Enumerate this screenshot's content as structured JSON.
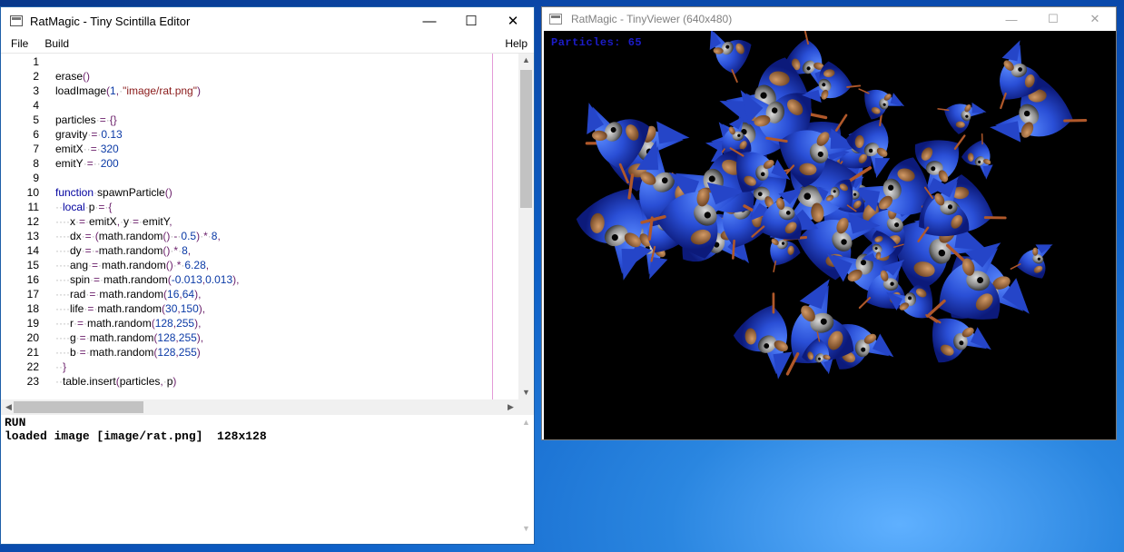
{
  "editor": {
    "title": "RatMagic - Tiny Scintilla Editor",
    "menu": {
      "file": "File",
      "build": "Build",
      "help": "Help"
    },
    "window_buttons": {
      "minimize": "—",
      "maximize": "☐",
      "close": "✕"
    },
    "code_lines": [
      {
        "n": "1",
        "h": ""
      },
      {
        "n": "2",
        "h": "erase<span class='op'>()</span>"
      },
      {
        "n": "3",
        "h": "loadImage<span class='op'>(</span><span class='num'>1</span><span class='op'>,</span><span class='ws'>·</span><span class='str'>\"image/rat.png\"</span><span class='op'>)</span>"
      },
      {
        "n": "4",
        "h": ""
      },
      {
        "n": "5",
        "h": "particles<span class='ws'>·</span><span class='op'>=</span><span class='ws'>·</span><span class='op'>{}</span>"
      },
      {
        "n": "6",
        "h": "gravity<span class='ws'>·</span><span class='op'>=</span><span class='ws'>·</span><span class='num'>0.13</span>"
      },
      {
        "n": "7",
        "h": "emitX<span class='ws'>··</span><span class='op'>=</span><span class='ws'>·</span><span class='num'>320</span>"
      },
      {
        "n": "8",
        "h": "emitY<span class='ws'>·</span><span class='op'>=</span><span class='ws'>··</span><span class='num'>200</span>"
      },
      {
        "n": "9",
        "h": ""
      },
      {
        "n": "10",
        "h": "<span class='kw'>function</span><span class='ws'>·</span>spawnParticle<span class='op'>()</span>"
      },
      {
        "n": "11",
        "h": "<span class='ws'>··</span><span class='kw'>local</span><span class='ws'>·</span>p<span class='ws'>·</span><span class='op'>=</span><span class='ws'>·</span><span class='op'>{</span>"
      },
      {
        "n": "12",
        "h": "<span class='ws'>····</span>x<span class='ws'>·</span><span class='op'>=</span><span class='ws'>·</span>emitX<span class='op'>,</span><span class='ws'>·</span>y<span class='ws'>·</span><span class='op'>=</span><span class='ws'>·</span>emitY<span class='op'>,</span>"
      },
      {
        "n": "13",
        "h": "<span class='ws'>····</span>dx<span class='ws'>·</span><span class='op'>=</span><span class='ws'>·</span><span class='op'>(</span>math.random<span class='op'>()</span><span class='ws'>·</span><span class='op'>-</span><span class='ws'>·</span><span class='num'>0.5</span><span class='op'>)</span><span class='ws'>·</span><span class='op'>*</span><span class='ws'>·</span><span class='num'>8</span><span class='op'>,</span>"
      },
      {
        "n": "14",
        "h": "<span class='ws'>····</span>dy<span class='ws'>·</span><span class='op'>=</span><span class='ws'>·</span><span class='op'>-</span>math.random<span class='op'>()</span><span class='ws'>·</span><span class='op'>*</span><span class='ws'>·</span><span class='num'>8</span><span class='op'>,</span>"
      },
      {
        "n": "15",
        "h": "<span class='ws'>····</span>ang<span class='ws'>·</span><span class='op'>=</span><span class='ws'>·</span>math.random<span class='op'>()</span><span class='ws'>·</span><span class='op'>*</span><span class='ws'>·</span><span class='num'>6.28</span><span class='op'>,</span>"
      },
      {
        "n": "16",
        "h": "<span class='ws'>····</span>spin<span class='ws'>·</span><span class='op'>=</span><span class='ws'>·</span>math.random<span class='op'>(</span><span class='num'>-0.013</span><span class='op'>,</span><span class='num'>0.013</span><span class='op'>),</span>"
      },
      {
        "n": "17",
        "h": "<span class='ws'>····</span>rad<span class='ws'>·</span><span class='op'>=</span><span class='ws'>·</span>math.random<span class='op'>(</span><span class='num'>16</span><span class='op'>,</span><span class='num'>64</span><span class='op'>),</span>"
      },
      {
        "n": "18",
        "h": "<span class='ws'>····</span>life<span class='ws'>·</span><span class='op'>=</span><span class='ws'>·</span>math.random<span class='op'>(</span><span class='num'>30</span><span class='op'>,</span><span class='num'>150</span><span class='op'>),</span>"
      },
      {
        "n": "19",
        "h": "<span class='ws'>····</span>r<span class='ws'>·</span><span class='op'>=</span><span class='ws'>·</span>math.random<span class='op'>(</span><span class='num'>128</span><span class='op'>,</span><span class='num'>255</span><span class='op'>),</span>"
      },
      {
        "n": "20",
        "h": "<span class='ws'>····</span>g<span class='ws'>·</span><span class='op'>=</span><span class='ws'>·</span>math.random<span class='op'>(</span><span class='num'>128</span><span class='op'>,</span><span class='num'>255</span><span class='op'>),</span>"
      },
      {
        "n": "21",
        "h": "<span class='ws'>····</span>b<span class='ws'>·</span><span class='op'>=</span><span class='ws'>·</span>math.random<span class='op'>(</span><span class='num'>128</span><span class='op'>,</span><span class='num'>255</span><span class='op'>)</span>"
      },
      {
        "n": "22",
        "h": "<span class='ws'>··</span><span class='op'>}</span>"
      },
      {
        "n": "23",
        "h": "<span class='ws'>··</span>table.insert<span class='op'>(</span>particles<span class='op'>,</span><span class='ws'>·</span>p<span class='op'>)</span>"
      }
    ],
    "output_lines": [
      "RUN",
      "loaded image [image/rat.png]  128x128"
    ],
    "scroll_arrows": {
      "up": "▲",
      "down": "▼",
      "left": "◀",
      "right": "▶"
    }
  },
  "viewer": {
    "title": "RatMagic - TinyViewer (640x480)",
    "window_buttons": {
      "minimize": "—",
      "maximize": "☐",
      "close": "✕"
    },
    "particles_label": "Particles: 65"
  },
  "colors": {
    "desktop": "#0d5fc7",
    "keyword": "#00009e",
    "number": "#0b3aa6",
    "string": "#8a1a1a",
    "particles_text": "#1c1cc8"
  }
}
